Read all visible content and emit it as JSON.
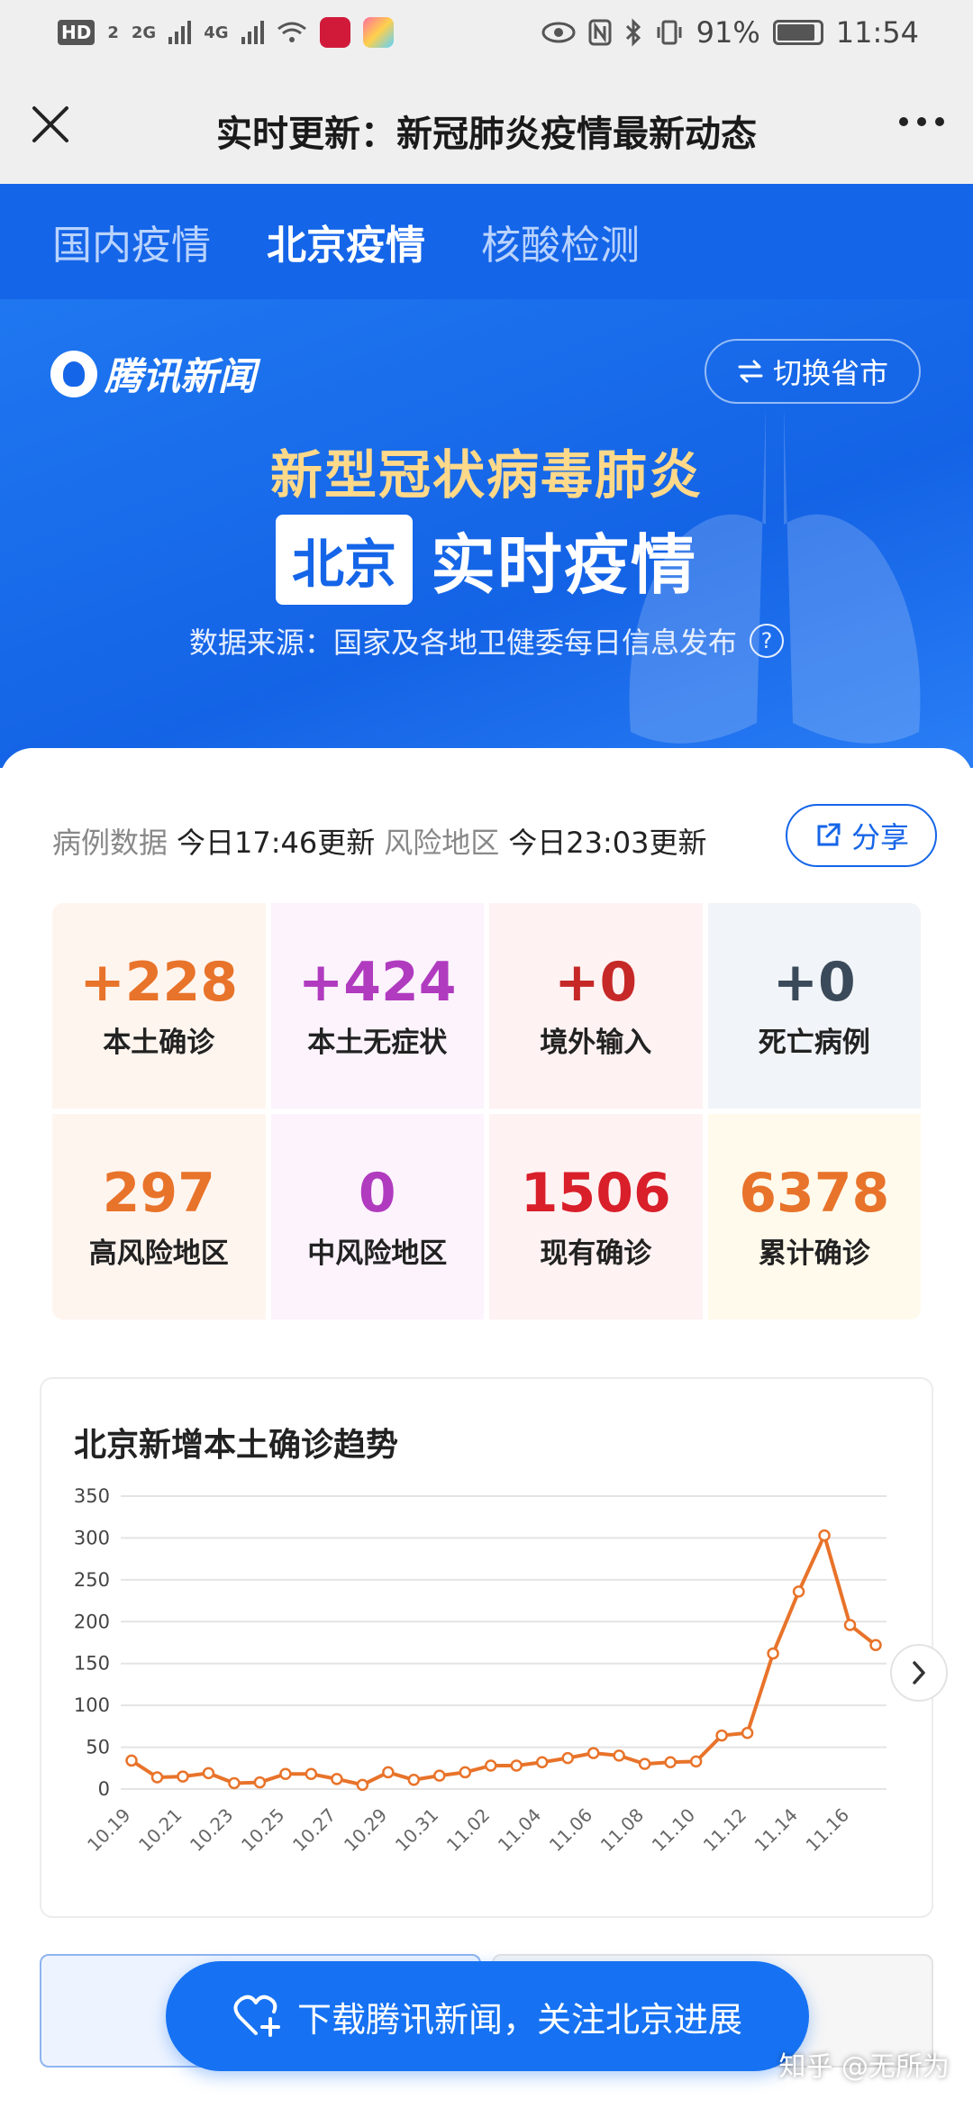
{
  "status_bar": {
    "hd_badge": "HD",
    "sim_badge": "2",
    "net1": "2G",
    "net2": "4G",
    "battery": "91%",
    "time": "11:54",
    "icons": [
      "hd-icon",
      "signal-icon",
      "wifi-icon",
      "tiktok-icon",
      "app-icon",
      "eye-icon",
      "nfc-icon",
      "bluetooth-icon",
      "vibrate-icon",
      "battery-icon"
    ]
  },
  "title_bar": {
    "title": "实时更新：新冠肺炎疫情最新动态"
  },
  "tabs": [
    {
      "label": "国内疫情",
      "active": false
    },
    {
      "label": "北京疫情",
      "active": true
    },
    {
      "label": "核酸检测",
      "active": false
    }
  ],
  "banner": {
    "brand": "腾讯新闻",
    "switch_label": "切换省市",
    "subtitle": "新型冠状病毒肺炎",
    "city": "北京",
    "headline": "实时疫情",
    "source": "数据来源：国家及各地卫健委每日信息发布"
  },
  "update": {
    "case_label": "病例数据",
    "case_time": "今日17:46更新",
    "risk_label": "风险地区",
    "risk_time": "今日23:03更新",
    "share_label": "分享"
  },
  "stats": [
    {
      "value": "+228",
      "label": "本土确诊",
      "color": "#e8732a",
      "bg": "#fff5ef"
    },
    {
      "value": "+424",
      "label": "本土无症状",
      "color": "#b03bbf",
      "bg": "#fcf3fd"
    },
    {
      "value": "+0",
      "label": "境外输入",
      "color": "#c62828",
      "bg": "#fff2f2"
    },
    {
      "value": "+0",
      "label": "死亡病例",
      "color": "#3b4a5a",
      "bg": "#f1f4f8"
    },
    {
      "value": "297",
      "label": "高风险地区",
      "color": "#e8732a",
      "bg": "#fff5ef"
    },
    {
      "value": "0",
      "label": "中风险地区",
      "color": "#b03bbf",
      "bg": "#fcf3fd"
    },
    {
      "value": "1506",
      "label": "现有确诊",
      "color": "#d81f2a",
      "bg": "#fff2f2"
    },
    {
      "value": "6378",
      "label": "累计确诊",
      "color": "#e8732a",
      "bg": "#fffaeb"
    }
  ],
  "chart_data": {
    "type": "line",
    "title": "北京新增本土确诊趋势",
    "x": [
      "10.19",
      "10.20",
      "10.21",
      "10.22",
      "10.23",
      "10.24",
      "10.25",
      "10.26",
      "10.27",
      "10.28",
      "10.29",
      "10.30",
      "10.31",
      "11.01",
      "11.02",
      "11.03",
      "11.04",
      "11.05",
      "11.06",
      "11.07",
      "11.08",
      "11.09",
      "11.10",
      "11.11",
      "11.12",
      "11.13",
      "11.14",
      "11.15",
      "11.16"
    ],
    "tick_labels": [
      "10.19",
      "10.21",
      "10.23",
      "10.25",
      "10.27",
      "10.29",
      "10.31",
      "11.02",
      "11.04",
      "11.06",
      "11.08",
      "11.10",
      "11.12",
      "11.14",
      "11.16"
    ],
    "series": [
      {
        "values": [
          34,
          14,
          15,
          19,
          7,
          8,
          18,
          18,
          12,
          5,
          20,
          11,
          16,
          20,
          28,
          28,
          32,
          37,
          43,
          40,
          30,
          32,
          33,
          64,
          67,
          162,
          236,
          303,
          196,
          172
        ],
        "color": "#e8732a"
      }
    ],
    "ylim": [
      0,
      350
    ],
    "yticks": [
      0,
      50,
      100,
      150,
      200,
      250,
      300,
      350
    ],
    "grid": true
  },
  "download": {
    "label": "下载腾讯新闻，关注北京进展"
  },
  "watermark": "知乎 @无所为"
}
